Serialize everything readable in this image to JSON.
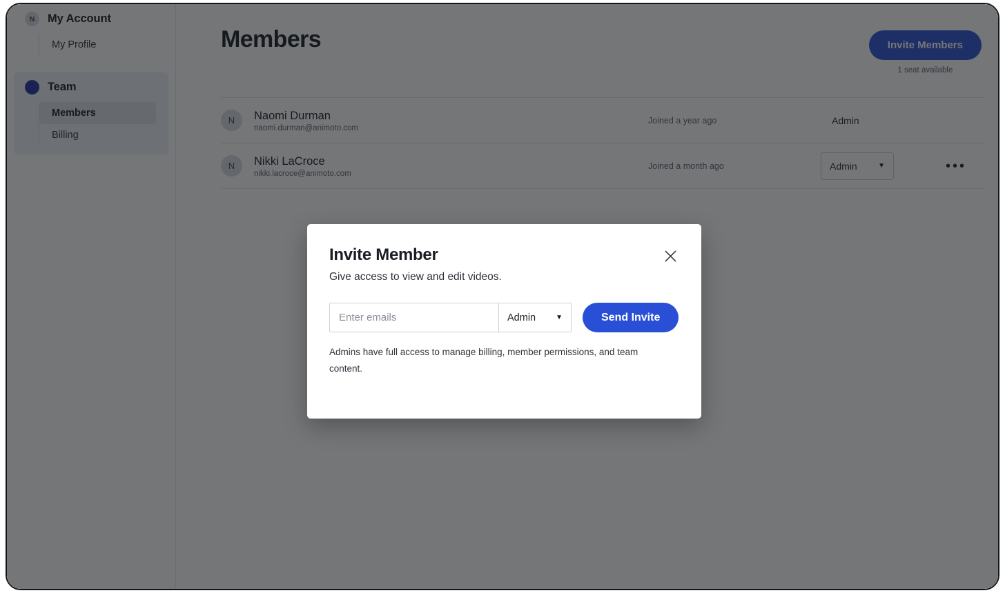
{
  "sidebar": {
    "groups": [
      {
        "id": "my-account",
        "label": "My Account",
        "avatar_initial": "N",
        "items": [
          {
            "label": "My Profile",
            "selected": false
          }
        ]
      },
      {
        "id": "team",
        "label": "Team",
        "dot_color": "#1f2f9e",
        "items": [
          {
            "label": "Members",
            "selected": true
          },
          {
            "label": "Billing",
            "selected": false
          }
        ]
      }
    ]
  },
  "main": {
    "page_title": "Members",
    "invite_button_label": "Invite Members",
    "seat_note": "1 seat available",
    "members": [
      {
        "avatar_initial": "N",
        "name": "Naomi Durman",
        "email": "naomi.durman@animoto.com",
        "joined": "Joined a year ago",
        "role": "Admin",
        "role_is_select": false,
        "has_menu": false
      },
      {
        "avatar_initial": "N",
        "name": "Nikki LaCroce",
        "email": "nikki.lacroce@animoto.com",
        "joined": "Joined a month ago",
        "role": "Admin",
        "role_is_select": true,
        "has_menu": true,
        "menu_glyph": "•••"
      }
    ]
  },
  "modal": {
    "title": "Invite Member",
    "subtitle": "Give access to view and edit videos.",
    "close_glyph": "✕",
    "email_placeholder": "Enter emails",
    "email_value": "",
    "role_value": "Admin",
    "role_options": [
      "Admin"
    ],
    "send_label": "Send Invite",
    "help_text": "Admins have full access to manage billing, member permissions, and team content."
  },
  "colors": {
    "accent_blue": "#2a4fd7",
    "team_dot": "#1f2f9e",
    "scrim": "rgba(24,26,30,0.60)"
  }
}
